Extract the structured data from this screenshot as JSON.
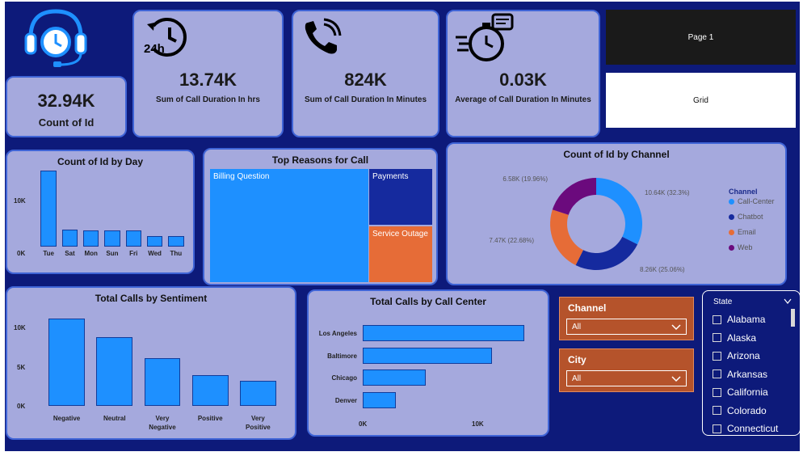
{
  "kpis": {
    "count_id": {
      "value": "32.94K",
      "label": "Count of Id"
    },
    "call_hrs": {
      "value": "13.74K",
      "label": "Sum of Call Duration In hrs"
    },
    "call_min": {
      "value": "824K",
      "label": "Sum of Call Duration In Minutes"
    },
    "avg_min": {
      "value": "0.03K",
      "label": "Average of Call Duration In Minutes"
    },
    "hrs_icon_text": "24h"
  },
  "nav": {
    "page1": "Page 1",
    "grid": "Grid"
  },
  "colors": {
    "background": "#0d1a7a",
    "card": "#a5a9dd",
    "bar": "#1e90ff",
    "slicer": "#b5532b"
  },
  "by_day": {
    "title": "Count of Id by Day",
    "yticks": [
      "10K",
      "0K"
    ],
    "chart_data": {
      "type": "bar",
      "categories": [
        "Tue",
        "Sat",
        "Mon",
        "Sun",
        "Fri",
        "Wed",
        "Thu"
      ],
      "values": [
        9800,
        2150,
        2050,
        2050,
        2050,
        1350,
        1350
      ],
      "ylim": [
        0,
        10000
      ]
    }
  },
  "reasons": {
    "title": "Top Reasons for Call",
    "chart_data": {
      "type": "treemap",
      "items": [
        {
          "label": "Billing Question",
          "color": "#1e90ff"
        },
        {
          "label": "Payments",
          "color": "#152a9e"
        },
        {
          "label": "Service Outage",
          "color": "#e66c37"
        }
      ]
    }
  },
  "channel": {
    "title": "Count of Id by Channel",
    "legend_title": "Channel",
    "chart_data": {
      "type": "pie",
      "series": [
        {
          "name": "Call-Center",
          "value": 10.64,
          "label": "10.64K (32.3%)",
          "color": "#1e90ff"
        },
        {
          "name": "Chatbot",
          "value": 8.26,
          "label": "8.26K (25.06%)",
          "color": "#152a9e"
        },
        {
          "name": "Email",
          "value": 7.47,
          "label": "7.47K (22.68%)",
          "color": "#e66c37"
        },
        {
          "name": "Web",
          "value": 6.58,
          "label": "6.58K (19.96%)",
          "color": "#6b0a7d"
        }
      ]
    }
  },
  "sentiment": {
    "title": "Total Calls by Sentiment",
    "yticks": [
      "10K",
      "5K",
      "0K"
    ],
    "chart_data": {
      "type": "bar",
      "categories": [
        "Negative",
        "Neutral",
        "Very Negative",
        "Positive",
        "Very Positive"
      ],
      "values": [
        11000,
        8700,
        6000,
        3900,
        3200
      ],
      "ylim": [
        0,
        10000
      ]
    }
  },
  "callcenter": {
    "title": "Total Calls by Call Center",
    "xticks": [
      "0K",
      "10K"
    ],
    "chart_data": {
      "type": "bar",
      "orientation": "horizontal",
      "categories": [
        "Los Angeles",
        "Baltimore",
        "Chicago",
        "Denver"
      ],
      "values": [
        13800,
        11000,
        5400,
        2800
      ],
      "xlim": [
        0,
        10000
      ]
    }
  },
  "slicers": {
    "channel": {
      "title": "Channel",
      "value": "All"
    },
    "city": {
      "title": "City",
      "value": "All"
    }
  },
  "states": {
    "title": "State",
    "items": [
      "Alabama",
      "Alaska",
      "Arizona",
      "Arkansas",
      "California",
      "Colorado",
      "Connecticut"
    ]
  }
}
